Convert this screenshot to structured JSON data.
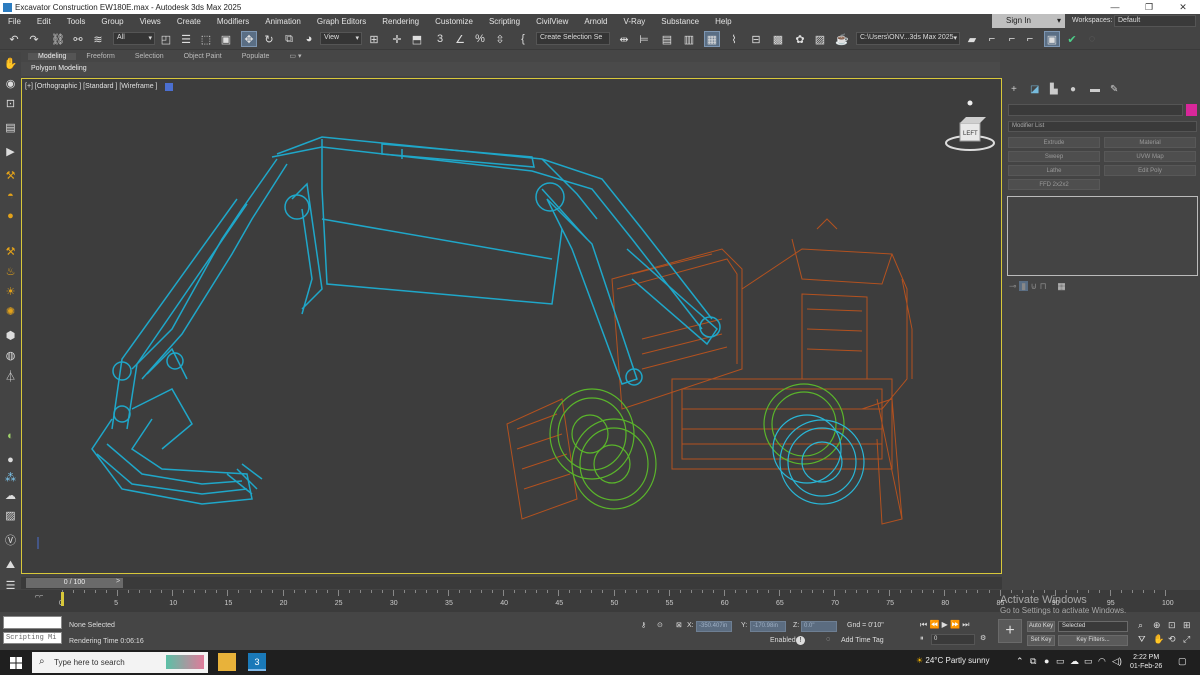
{
  "window": {
    "title": "Excavator Construction EW180E.max - Autodesk 3ds Max 2025",
    "minimize": "—",
    "maximize": "❐",
    "close": "✕"
  },
  "menu": [
    "File",
    "Edit",
    "Tools",
    "Group",
    "Views",
    "Create",
    "Modifiers",
    "Animation",
    "Graph Editors",
    "Rendering",
    "Customize",
    "Scripting",
    "CivilView",
    "Arnold",
    "V-Ray",
    "Substance",
    "Help"
  ],
  "signin": {
    "label": "Sign In",
    "caret": "▾"
  },
  "workspaces": {
    "label": "Workspaces:",
    "value": "Default"
  },
  "toolbar": {
    "filter_value": "All",
    "view_value": "View",
    "selection_set": "Create Selection Se",
    "path_value": "C:\\Users\\ONV...3ds Max 2025"
  },
  "ribbon": {
    "tabs": [
      "Modeling",
      "Freeform",
      "Selection",
      "Object Paint",
      "Populate"
    ],
    "active": "Modeling",
    "sub_label": "Polygon Modeling"
  },
  "viewport": {
    "label": "[+] [Orthographic ] [Standard ] [Wireframe ]",
    "cube_label": "LEFT"
  },
  "command_panel": {
    "modifier_list": "Modifier List",
    "buttons": [
      "Extrude",
      "Material",
      "Sweep",
      "UVW Map",
      "Lathe",
      "Edit Poly",
      "FFD 2x2x2"
    ]
  },
  "timeline": {
    "slider_label": "0 / 100",
    "prev": "<",
    "next": ">"
  },
  "ruler": {
    "ticks": [
      "0",
      "5",
      "10",
      "15",
      "20",
      "25",
      "30",
      "35",
      "40",
      "45",
      "50",
      "55",
      "60",
      "65",
      "70",
      "75",
      "80",
      "85",
      "90",
      "95",
      "100"
    ]
  },
  "status": {
    "scripting_mini": "Scripting Mi",
    "none_selected": "None Selected",
    "rendering_time": "Rendering Time  0:06:16",
    "x_label": "X:",
    "x_value": "-350.407in",
    "y_label": "Y:",
    "y_value": "-170.98in",
    "z_label": "Z:",
    "z_value": "0.0\"",
    "grid": "Gnd = 0'10\"",
    "enabled": "Enabled:",
    "add_time_tag": "Add Time Tag",
    "auto_key": "Auto Key",
    "selected": "Selected",
    "set_key": "Set Key",
    "key_filters": "Key Filters...",
    "frame_value": "0"
  },
  "activate_windows": {
    "line1": "Activate Windows",
    "line2": "Go to Settings to activate Windows."
  },
  "taskbar": {
    "search_placeholder": "Type here to search",
    "weather": "24°C  Partly sunny",
    "time": "2:22 PM",
    "date": "01-Feb-26"
  },
  "colors": {
    "accent": "#1fa7c9",
    "body": "#c0541c",
    "wheels_green": "#5ab52b",
    "wheels_cyan": "#29b6d6",
    "viewport_border": "#d8c83a"
  }
}
